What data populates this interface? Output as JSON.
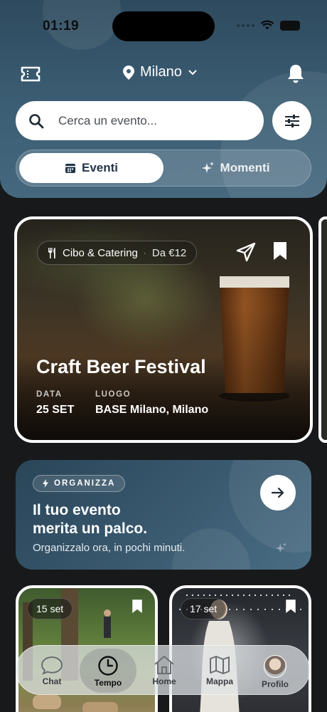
{
  "status_bar": {
    "time": "01:19"
  },
  "header": {
    "location": "Milano",
    "search": {
      "placeholder": "Cerca un evento..."
    },
    "tabs": [
      {
        "label": "Eventi",
        "icon": "calendar-icon",
        "active": true
      },
      {
        "label": "Momenti",
        "icon": "sparkles-icon",
        "active": false
      }
    ]
  },
  "featured": {
    "category": "Cibo & Catering",
    "separator": "·",
    "price": "Da €12",
    "title": "Craft Beer Festival",
    "date_label": "DATA",
    "date_value": "25 SET",
    "place_label": "LUOGO",
    "place_value": "BASE Milano, Milano"
  },
  "promo": {
    "tag": "ORGANIZZA",
    "title_line1": "Il tuo evento",
    "title_line2": "merita un palco.",
    "subtitle": "Organizzalo ora, in pochi minuti."
  },
  "cards": [
    {
      "date": "15 set"
    },
    {
      "date": "17 set"
    }
  ],
  "tabbar": {
    "items": [
      {
        "label": "Chat",
        "icon": "chat-icon"
      },
      {
        "label": "Tempo",
        "icon": "clock-icon",
        "active": true
      },
      {
        "label": "Home",
        "icon": "home-icon"
      },
      {
        "label": "Mappa",
        "icon": "map-icon"
      },
      {
        "label": "Profilo",
        "icon": "avatar"
      }
    ]
  },
  "colors": {
    "accent": "#22364a",
    "header": "#3c5e74",
    "background": "#17191b"
  }
}
